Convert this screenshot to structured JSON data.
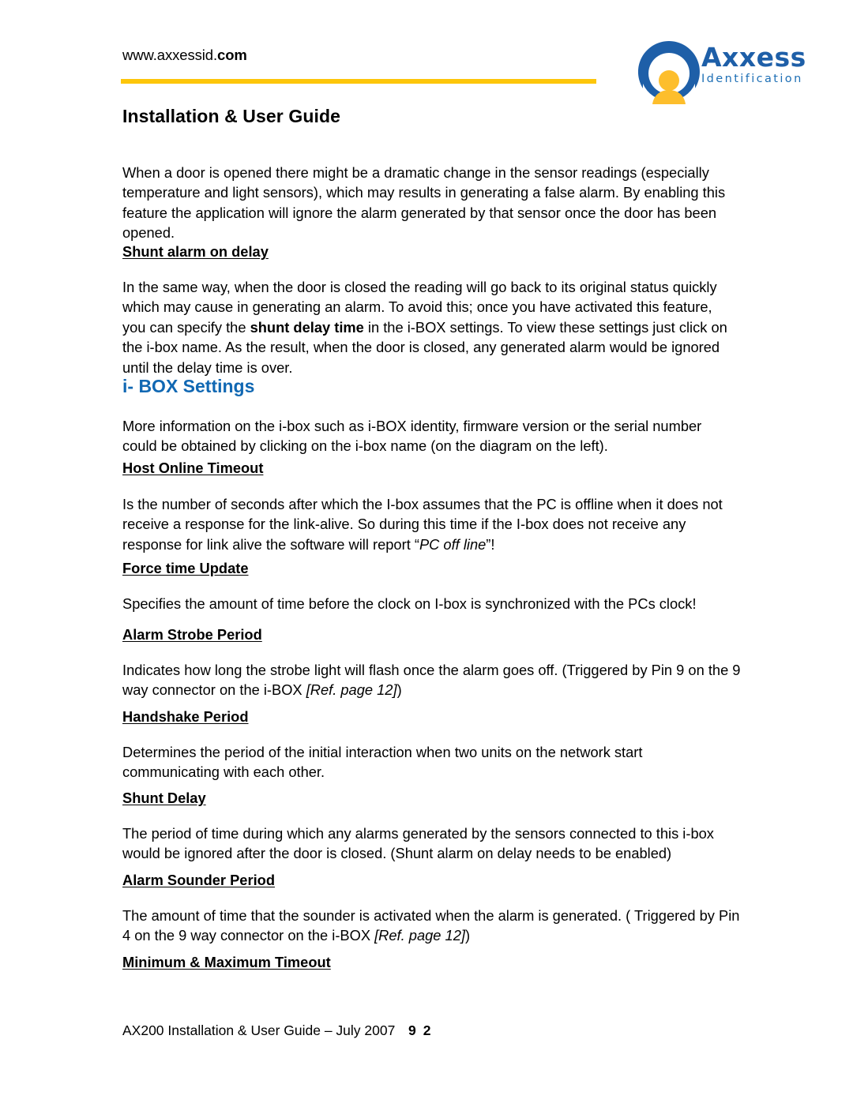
{
  "header": {
    "site_url_prefix": "www.axxessid.",
    "site_url_suffix": "com",
    "doc_title": "Installation & User Guide",
    "rule_color": "#FDC60B"
  },
  "logo": {
    "brand_name": "Axxess",
    "brand_tagline": "Identification",
    "mark_icon": "person-in-circle-icon",
    "blue": "#1e5fa8",
    "yellow": "#FDBE2C"
  },
  "content": {
    "intro_paragraph": "When a door is opened there might be a dramatic change in the sensor readings (especially temperature and light sensors), which may results in generating a false alarm. By enabling this feature the application will ignore the alarm generated by that sensor once the door has been opened.",
    "shunt_alarm_on_delay": {
      "heading": "Shunt alarm on delay",
      "text_part1": "In the same way, when the door is closed the reading will go back to its original status quickly which may cause in generating an alarm. To avoid this; once you have activated this feature, you can specify the ",
      "text_bold": "shunt delay time",
      "text_part2": " in the i-BOX settings. To view these settings just click on the i-box name. As the result, when the door is closed, any generated alarm would be ignored until the delay time is over."
    },
    "ibox_settings": {
      "heading": "i- BOX Settings",
      "paragraph": "More information on the i-box such as i-BOX identity, firmware version or the serial number could be obtained by clicking on the i-box name (on the diagram on the left)."
    },
    "host_online_timeout": {
      "heading": "Host Online Timeout",
      "text_part1": "Is the number of seconds after which the I-box assumes that the PC is offline when it does not receive a response for the link-alive. So during this time if the I-box does not receive any response for link alive the software will report “",
      "text_italic": "PC off line",
      "text_part2": "”!"
    },
    "force_time_update": {
      "heading": "Force time Update",
      "paragraph": "Specifies the amount of time before the clock on I-box is synchronized with the PCs clock!"
    },
    "alarm_strobe_period": {
      "heading": "Alarm Strobe Period",
      "text_part1": "Indicates how long the strobe light will flash once the alarm goes off. (Triggered by Pin 9 on the 9 way connector on the i-BOX ",
      "text_italic": "[Ref. page 12]",
      "text_part2": ")"
    },
    "handshake_period": {
      "heading": "Handshake Period",
      "paragraph": "Determines the period of the initial interaction when two units on the network start communicating with each other."
    },
    "shunt_delay": {
      "heading": "Shunt Delay",
      "paragraph": "The period of time during which any alarms generated by the sensors connected to this i-box would be ignored after the door is closed. (Shunt alarm on delay needs to be enabled)"
    },
    "alarm_sounder_period": {
      "heading": "Alarm Sounder Period",
      "text_part1": "The amount of time that the sounder is activated when the alarm is generated. ( Triggered by Pin 4 on the 9 way connector on the i-BOX ",
      "text_italic": "[Ref. page 12]",
      "text_part2": ")"
    },
    "minimum_maximum_timeout": {
      "heading": "Minimum & Maximum Timeout"
    }
  },
  "footer": {
    "document_line": "AX200 Installation & User Guide – July 2007",
    "page_number_part1": "9",
    "page_number_part2": "2"
  }
}
